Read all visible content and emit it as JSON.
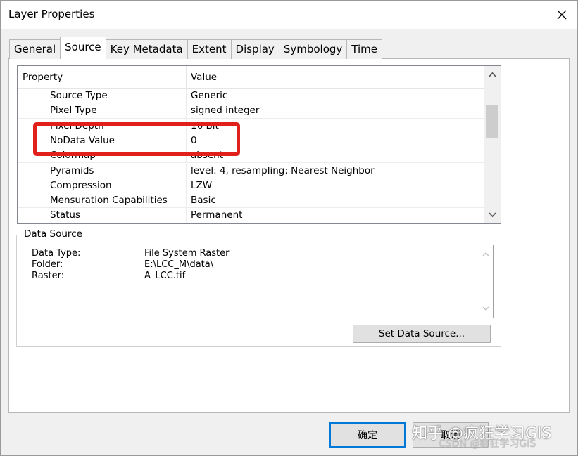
{
  "window": {
    "title": "Layer Properties"
  },
  "tabs": [
    {
      "label": "General",
      "active": false
    },
    {
      "label": "Source",
      "active": true
    },
    {
      "label": "Key Metadata",
      "active": false
    },
    {
      "label": "Extent",
      "active": false
    },
    {
      "label": "Display",
      "active": false
    },
    {
      "label": "Symbology",
      "active": false
    },
    {
      "label": "Time",
      "active": false
    }
  ],
  "property_grid": {
    "columns": {
      "property": "Property",
      "value": "Value"
    },
    "rows": [
      {
        "name": "Source Type",
        "value": "Generic"
      },
      {
        "name": "Pixel Type",
        "value": "signed integer"
      },
      {
        "name": "Pixel Depth",
        "value": "16 Bit"
      },
      {
        "name": "NoData Value",
        "value": "0"
      },
      {
        "name": "Colormap",
        "value": "absent"
      },
      {
        "name": "Pyramids",
        "value": "level: 4, resampling: Nearest Neighbor"
      },
      {
        "name": "Compression",
        "value": "LZW"
      },
      {
        "name": "Mensuration Capabilities",
        "value": "Basic"
      },
      {
        "name": "Status",
        "value": "Permanent"
      }
    ]
  },
  "data_source": {
    "group_label": "Data Source",
    "entries": [
      {
        "key": "Data Type:",
        "value": "File System Raster"
      },
      {
        "key": "Folder:",
        "value": "E:\\LCC_M\\data\\"
      },
      {
        "key": "Raster:",
        "value": "A_LCC.tif"
      }
    ],
    "set_button": "Set Data Source..."
  },
  "buttons": {
    "ok": "确定",
    "cancel": "取消"
  },
  "watermark": {
    "line1": "知乎 @疯狂学习GIS",
    "line2": "CSDN @疯狂学习GIS"
  },
  "colors": {
    "highlight": "#e0201b",
    "default_button_border": "#0078d7"
  }
}
